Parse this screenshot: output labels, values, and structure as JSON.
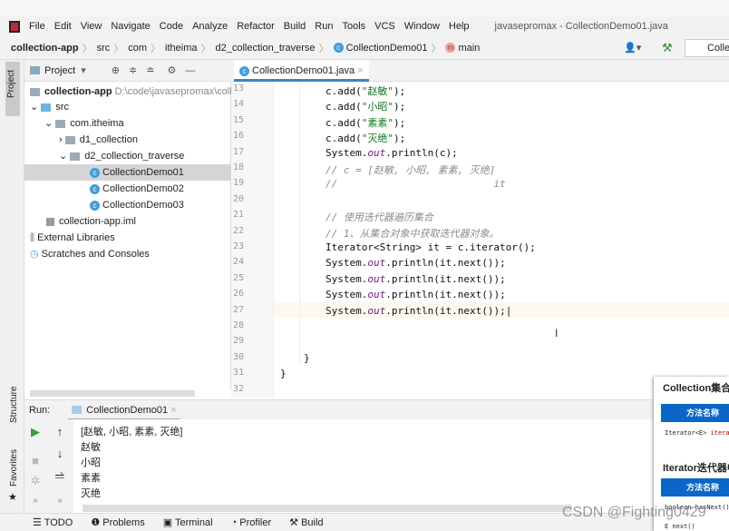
{
  "menubar": {
    "items": [
      "File",
      "Edit",
      "View",
      "Navigate",
      "Code",
      "Analyze",
      "Refactor",
      "Build",
      "Run",
      "Tools",
      "VCS",
      "Window",
      "Help"
    ],
    "title": "javasepromax - CollectionDemo01.java"
  },
  "breadcrumb": {
    "items": [
      "collection-app",
      "src",
      "com",
      "itheima",
      "d2_collection_traverse",
      "CollectionDemo01",
      "main"
    ],
    "run_config": "Colle"
  },
  "sidebar": {
    "project_tab": "Project",
    "structure_tab": "Structure",
    "favorites_tab": "Favorites"
  },
  "project": {
    "header": "Project",
    "tree": [
      {
        "label": "collection-app",
        "path": "D:\\code\\javasepromax\\colle"
      },
      {
        "label": "src"
      },
      {
        "label": "com.itheima"
      },
      {
        "label": "d1_collection"
      },
      {
        "label": "d2_collection_traverse"
      },
      {
        "label": "CollectionDemo01",
        "selected": true
      },
      {
        "label": "CollectionDemo02"
      },
      {
        "label": "CollectionDemo03"
      },
      {
        "label": "collection-app.iml"
      },
      {
        "label": "External Libraries"
      },
      {
        "label": "Scratches and Consoles"
      }
    ]
  },
  "editor": {
    "tab": "CollectionDemo01.java",
    "line_numbers": [
      "13",
      "14",
      "15",
      "16",
      "17",
      "18",
      "19",
      "20",
      "21",
      "22",
      "23",
      "24",
      "25",
      "26",
      "27",
      "28",
      "29",
      "30",
      "31",
      "32"
    ],
    "lines": [
      {
        "pre": "c.add(",
        "str": "\"赵敏\"",
        "post": ");"
      },
      {
        "pre": "c.add(",
        "str": "\"小昭\"",
        "post": ");"
      },
      {
        "pre": "c.add(",
        "str": "\"素素\"",
        "post": ");"
      },
      {
        "pre": "c.add(",
        "str": "\"灭绝\"",
        "post": ");"
      },
      {
        "pre": "System.",
        "fld": "out",
        "post": ".println(c);"
      },
      {
        "cm": "// c = [赵敏, 小昭, 素素, 灭绝]"
      },
      {
        "cm": "//                          it"
      },
      {},
      {
        "cm": "// 使用迭代器遍历集合"
      },
      {
        "cm": "// 1、从集合对象中获取迭代器对象。"
      },
      {
        "pre": "Iterator<String> it = c.iterator();"
      },
      {
        "pre": "System.",
        "fld": "out",
        "post": ".println(it.next());"
      },
      {
        "pre": "System.",
        "fld": "out",
        "post": ".println(it.next());"
      },
      {
        "pre": "System.",
        "fld": "out",
        "post": ".println(it.next());"
      },
      {
        "pre": "System.",
        "fld": "out",
        "post": ".println(it.next());"
      },
      {},
      {},
      {
        "pre": "}"
      },
      {
        "pre": "}"
      },
      {}
    ]
  },
  "run": {
    "label": "Run:",
    "tab": "CollectionDemo01",
    "output": [
      "[赵敏, 小昭, 素素, 灭绝]",
      "赵敏",
      "小昭",
      "素素",
      "灭绝"
    ]
  },
  "bottombar": {
    "items": [
      "TODO",
      "Problems",
      "Terminal",
      "Profiler",
      "Build"
    ]
  },
  "overlay": {
    "title1": "Collection集合",
    "header": "方法名称",
    "row1_type": "Iterator<E> ",
    "row1_method": "iterator()",
    "title2": "Iterator迭代器中",
    "row2": "boolean hasNext()",
    "row3": "E next()"
  },
  "watermark": "CSDN @Fighting0429"
}
